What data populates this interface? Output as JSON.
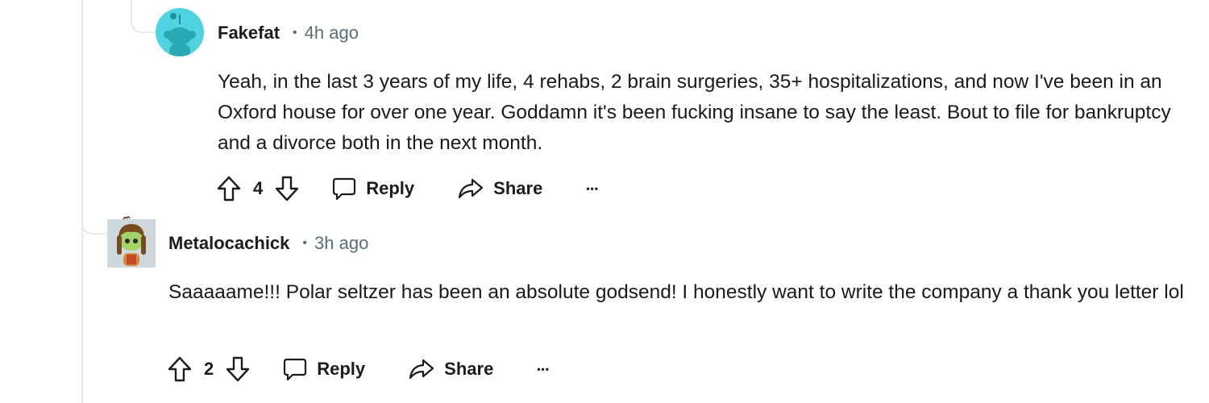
{
  "comments": [
    {
      "username": "Fakefat",
      "separator": "•",
      "time": "4h ago",
      "avatar": "reddit-snoo-default-avatar",
      "avatar_color": "#4fd3e0",
      "body": "Yeah, in the last 3 years of my life, 4 rehabs, 2 brain surgeries, 35+ hospitalizations, and now I've been in an Oxford house for over one year. Goddamn it's been fucking insane to say the least. Bout to file for bankruptcy and a divorce both in the next month.",
      "votes": "4",
      "reply_label": "Reply",
      "share_label": "Share",
      "more_label": "•••"
    },
    {
      "username": "Metalocachick",
      "separator": "•",
      "time": "3h ago",
      "avatar": "custom-snoo-avatar",
      "avatar_color": "#cfd8dc",
      "body": "Saaaaame!!! Polar seltzer has been an absolute godsend! I honestly want to write the company a thank you letter lol",
      "votes": "2",
      "reply_label": "Reply",
      "share_label": "Share",
      "more_label": "•••"
    }
  ],
  "icons": {
    "upvote": "arrow-up-icon",
    "downvote": "arrow-down-icon",
    "reply": "speech-bubble-icon",
    "share": "share-arrow-icon",
    "more": "ellipsis-icon"
  }
}
